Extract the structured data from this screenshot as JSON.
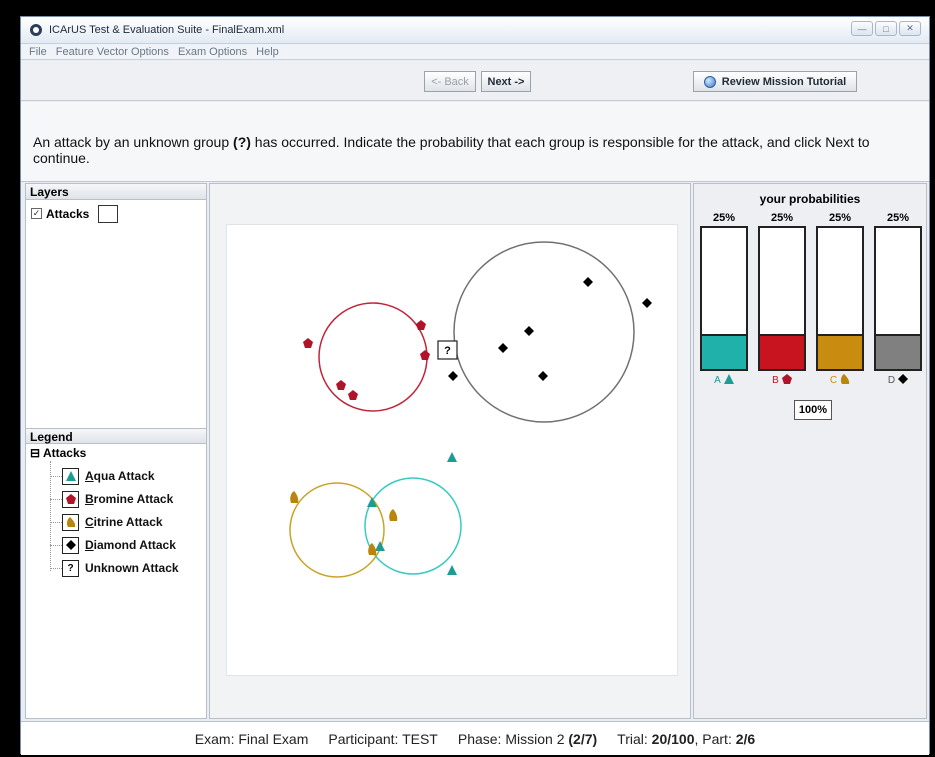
{
  "window": {
    "title": "ICArUS Test & Evaluation Suite - FinalExam.xml",
    "controls": [
      "—",
      "□",
      "✕"
    ]
  },
  "menu": [
    "File",
    "Feature Vector Options",
    "Exam Options",
    "Help"
  ],
  "toolbar": {
    "back_label": "<- Back",
    "next_label": "Next ->",
    "tutorial_label": "Review Mission Tutorial"
  },
  "instructions": {
    "before": "An attack by an unknown group ",
    "marker": "(?)",
    "after": " has occurred. Indicate the probability that each group is responsible for the attack, and click Next to continue."
  },
  "layers": {
    "title": "Layers",
    "item_label": "Attacks",
    "checked": true
  },
  "legend": {
    "title": "Legend",
    "root_label": "Attacks",
    "items": [
      {
        "first": "A",
        "rest": "qua Attack",
        "icon": "triangle-icon",
        "color": "#1c9c95"
      },
      {
        "first": "B",
        "rest": "romine Attack",
        "icon": "pentagon-icon",
        "color": "#b0142a"
      },
      {
        "first": "C",
        "rest": "itrine Attack",
        "icon": "blob-icon",
        "color": "#b8860b"
      },
      {
        "first": "D",
        "rest": "iamond Attack",
        "icon": "diamond-icon",
        "color": "#000000"
      },
      {
        "first": "",
        "rest": "Unknown Attack",
        "icon": "question-icon",
        "color": "#000000",
        "glyph": "?"
      }
    ]
  },
  "map": {
    "unknown_marker": "?"
  },
  "probabilities": {
    "title": "your probabilities",
    "total": "100%",
    "bars": [
      {
        "pct": "25%",
        "value": 0.25,
        "letter": "A",
        "color": "#20b2aa",
        "icon": "triangle-icon"
      },
      {
        "pct": "25%",
        "value": 0.25,
        "letter": "B",
        "color": "#c8141e",
        "icon": "pentagon-icon"
      },
      {
        "pct": "25%",
        "value": 0.25,
        "letter": "C",
        "color": "#c88c10",
        "icon": "blob-icon"
      },
      {
        "pct": "25%",
        "value": 0.25,
        "letter": "D",
        "color": "#808080",
        "icon": "diamond-icon"
      }
    ]
  },
  "status": {
    "exam_label": "Exam:",
    "exam": "Final Exam",
    "participant_label": "Participant:",
    "participant": "TEST",
    "phase_label": "Phase:",
    "phase": "Mission 2",
    "phase_count": "(2/7)",
    "trial_label": "Trial:",
    "trial": "20/100",
    "part_label": ", Part:",
    "part": "2/6"
  }
}
